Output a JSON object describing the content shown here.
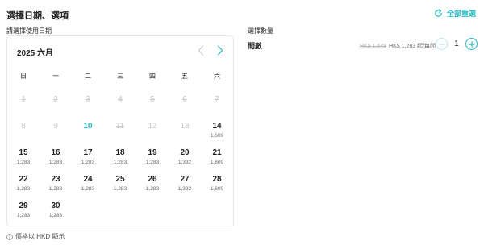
{
  "header": {
    "title": "選擇日期、選項",
    "reset_label": "全部重選"
  },
  "date_section": {
    "label": "請選擇使用日期"
  },
  "calendar": {
    "month_title": "2025 六月",
    "weekdays": [
      "日",
      "一",
      "二",
      "三",
      "四",
      "五",
      "六"
    ],
    "weeks": [
      [
        {
          "day": "1",
          "price": "",
          "state": "disabled"
        },
        {
          "day": "2",
          "price": "",
          "state": "disabled"
        },
        {
          "day": "3",
          "price": "",
          "state": "disabled"
        },
        {
          "day": "4",
          "price": "",
          "state": "disabled"
        },
        {
          "day": "5",
          "price": "",
          "state": "disabled"
        },
        {
          "day": "6",
          "price": "",
          "state": "disabled"
        },
        {
          "day": "7",
          "price": "",
          "state": "disabled"
        }
      ],
      [
        {
          "day": "8",
          "price": "",
          "state": "muted"
        },
        {
          "day": "9",
          "price": "",
          "state": "muted"
        },
        {
          "day": "10",
          "price": "",
          "state": "today"
        },
        {
          "day": "11",
          "price": "",
          "state": "disabled"
        },
        {
          "day": "12",
          "price": "",
          "state": "muted"
        },
        {
          "day": "13",
          "price": "",
          "state": "muted"
        },
        {
          "day": "14",
          "price": "1,609",
          "state": "available"
        }
      ],
      [
        {
          "day": "15",
          "price": "1,283",
          "state": "available"
        },
        {
          "day": "16",
          "price": "1,283",
          "state": "available"
        },
        {
          "day": "17",
          "price": "1,283",
          "state": "available"
        },
        {
          "day": "18",
          "price": "1,283",
          "state": "available"
        },
        {
          "day": "19",
          "price": "1,283",
          "state": "available"
        },
        {
          "day": "20",
          "price": "1,392",
          "state": "available"
        },
        {
          "day": "21",
          "price": "1,609",
          "state": "available"
        }
      ],
      [
        {
          "day": "22",
          "price": "1,283",
          "state": "available"
        },
        {
          "day": "23",
          "price": "1,283",
          "state": "available"
        },
        {
          "day": "24",
          "price": "1,283",
          "state": "available"
        },
        {
          "day": "25",
          "price": "1,283",
          "state": "available"
        },
        {
          "day": "26",
          "price": "1,283",
          "state": "available"
        },
        {
          "day": "27",
          "price": "1,392",
          "state": "available"
        },
        {
          "day": "28",
          "price": "1,609",
          "state": "available"
        }
      ],
      [
        {
          "day": "29",
          "price": "1,283",
          "state": "available"
        },
        {
          "day": "30",
          "price": "1,283",
          "state": "available"
        },
        {
          "day": "",
          "price": "",
          "state": "blank"
        },
        {
          "day": "",
          "price": "",
          "state": "blank"
        },
        {
          "day": "",
          "price": "",
          "state": "blank"
        },
        {
          "day": "",
          "price": "",
          "state": "blank"
        },
        {
          "day": "",
          "price": "",
          "state": "blank"
        }
      ]
    ]
  },
  "footnote": {
    "text": "價格以 HKD 顯示"
  },
  "quantity": {
    "label": "選擇數量",
    "room_label": "間數",
    "original_price": "HK$ 1,649",
    "price": "HK$ 1,283 起/每間",
    "value": "1"
  },
  "colors": {
    "accent": "#26b7bc",
    "disabled_text": "#c8c8c8",
    "minus_border": "#bfe6e8"
  },
  "icons": {
    "reset": "refresh-icon",
    "prev": "chevron-left-icon",
    "next": "chevron-right-icon",
    "info": "info-icon",
    "minus": "minus-icon",
    "plus": "plus-icon"
  }
}
